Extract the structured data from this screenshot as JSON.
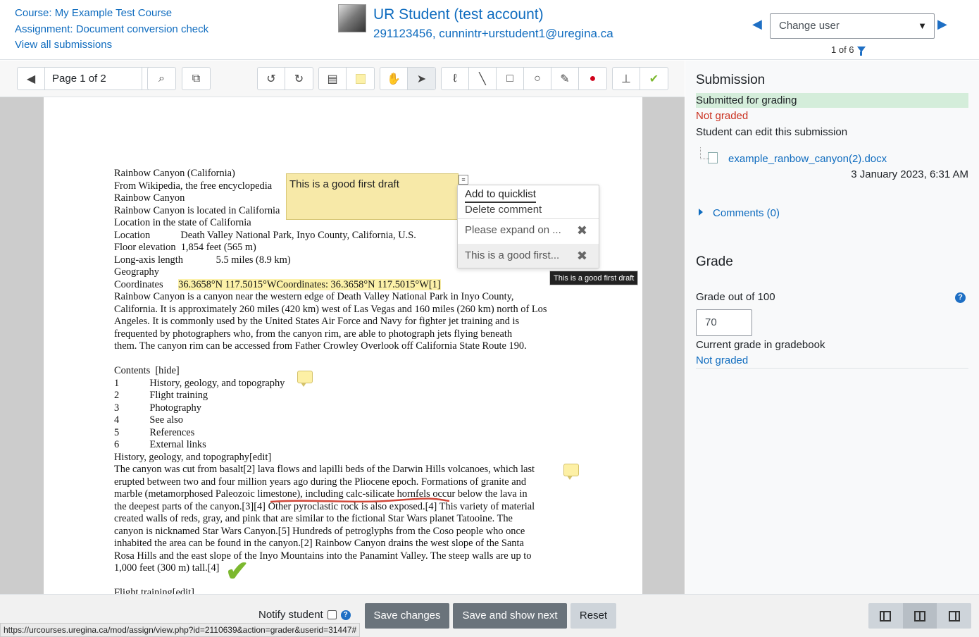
{
  "header": {
    "course": "Course: My Example Test Course",
    "assignment": "Assignment: Document conversion check",
    "view_all": "View all submissions",
    "user_name": "UR Student (test account)",
    "user_meta": "291123456, cunnintr+urstudent1@uregina.ca",
    "change_user": "Change user",
    "pager": "1 of 6"
  },
  "toolbar": {
    "page_label": "Page 1 of 2"
  },
  "document": {
    "lines": [
      "Rainbow Canyon (California)",
      "From Wikipedia, the free encyclopedia",
      "Rainbow Canyon",
      "Rainbow Canyon is located in California",
      "Location in the state of California",
      "Location            Death Valley National Park, Inyo County, California, U.S.",
      "Floor elevation  1,854 feet (565 m)",
      "Long-axis length             5.5 miles (8.9 km)",
      "Geography",
      "Coordinates      ",
      "Rainbow Canyon is a canyon near the western edge of Death Valley National Park in Inyo County,",
      "California. It is approximately 260 miles (420 km) west of Las Vegas and 160 miles (260 km) north of Los",
      "Angeles. It is commonly used by the United States Air Force and Navy for fighter jet training and is",
      "frequented by photographers who, from the canyon rim, are able to photograph jets flying beneath",
      "them. The canyon rim can be accessed from Father Crowley Overlook off California State Route 190.",
      "",
      "Contents  [hide]",
      "1            History, geology, and topography",
      "2            Flight training",
      "3            Photography",
      "4            See also",
      "5            References",
      "6            External links",
      "History, geology, and topography[edit]",
      "The canyon was cut from basalt[2] lava flows and lapilli beds of the Darwin Hills volcanoes, which last",
      "erupted between two and four million years ago during the Pliocene epoch. Formations of granite and",
      "marble (metamorphosed Paleozoic limestone), including calc-silicate hornfels occur below the lava in",
      "the deepest parts of the canyon.[3][4] Other pyroclastic rock is also exposed.[4] This variety of material",
      "created walls of reds, gray, and pink that are similar to the fictional Star Wars planet Tatooine. The",
      "canyon is nicknamed Star Wars Canyon.[5] Hundreds of petroglyphs from the Coso people who once",
      "inhabited the area can be found in the canyon.[2] Rainbow Canyon drains the west slope of the Santa",
      "Rosa Hills and the east slope of the Inyo Mountains into the Panamint Valley. The steep walls are up to",
      "1,000 feet (300 m) tall.[4]",
      "",
      "Flight training[edit]"
    ],
    "coordinates_highlight": "36.3658°N 117.5015°WCoordinates: 36.3658°N 117.5015°W[1]"
  },
  "annotation": {
    "comment_text": "This is a good first draft",
    "menu_add": "Add to quicklist",
    "menu_delete": "Delete comment",
    "quick1": "Please expand on ...",
    "quick2": "This is a good first...",
    "tooltip": "This is a good first draft"
  },
  "submission": {
    "title": "Submission",
    "status": "Submitted for grading",
    "graded": "Not graded",
    "edit": "Student can edit this submission",
    "file": "example_ranbow_canyon(2).docx",
    "date": "3 January 2023, 6:31 AM",
    "comments": "Comments (0)"
  },
  "grade": {
    "title": "Grade",
    "label": "Grade out of 100",
    "value": "70",
    "gradebook_label": "Current grade in gradebook",
    "gradebook_value": "Not graded"
  },
  "footer": {
    "notify": "Notify student",
    "save": "Save changes",
    "save_next": "Save and show next",
    "reset": "Reset"
  },
  "statusbar": "https://urcourses.uregina.ca/mod/assign/view.php?id=2110639&action=grader&userid=31447#"
}
